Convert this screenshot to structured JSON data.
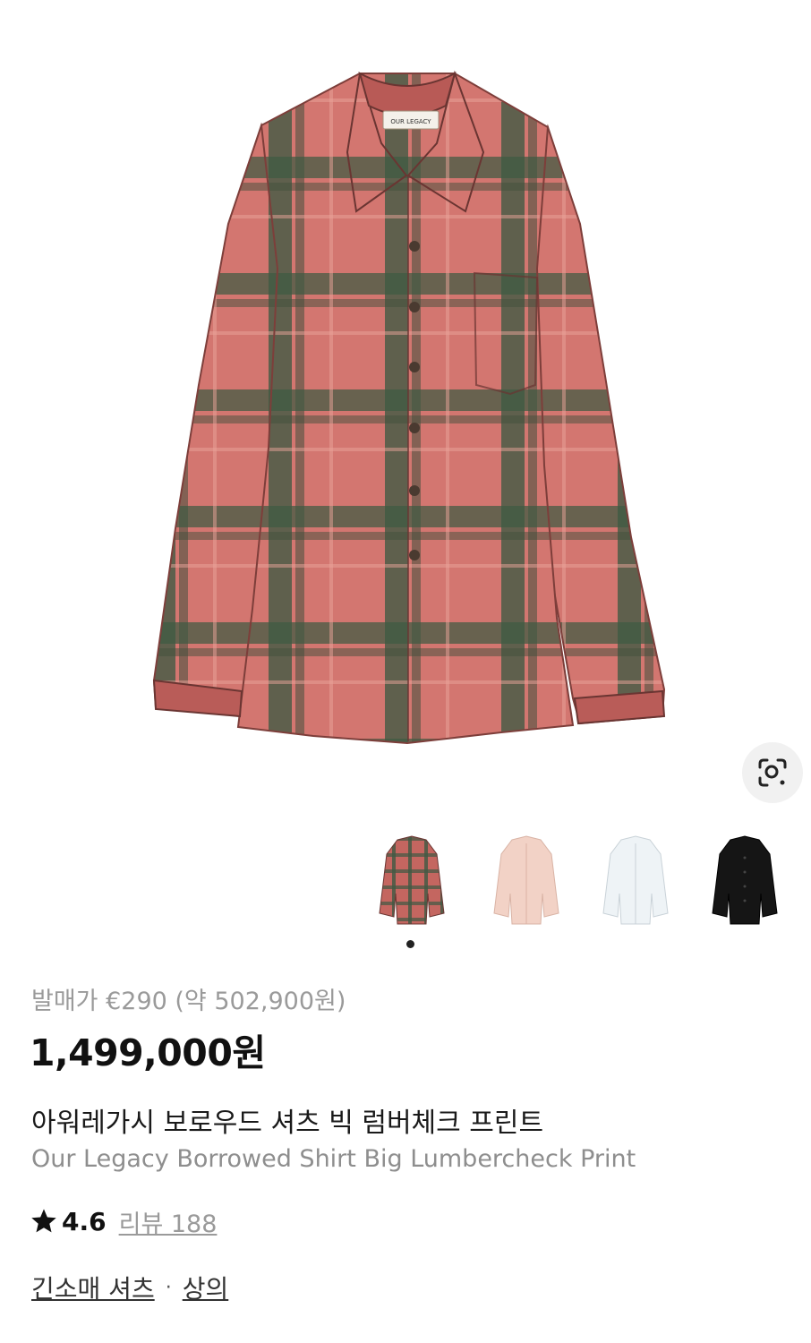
{
  "product": {
    "retail_price": "발매가 €290 (약 502,900원)",
    "price": "1,499,000원",
    "name_ko": "아워레가시 보로우드 셔츠 빅 럼버체크 프린트",
    "name_en": "Our Legacy Borrowed Shirt Big Lumbercheck Print",
    "brand_label": "OUR LEGACY",
    "rating": "4.6",
    "review_link": "리뷰 188",
    "categories": [
      "긴소매 셔츠",
      "상의"
    ],
    "separator": "·"
  },
  "gallery": {
    "thumbnails": [
      {
        "name": "red-check",
        "color": "#b0544f",
        "selected": true
      },
      {
        "name": "pink",
        "color": "#f2d2c6",
        "selected": false
      },
      {
        "name": "white",
        "color": "#eef2f4",
        "selected": false
      },
      {
        "name": "black",
        "color": "#151515",
        "selected": false
      }
    ],
    "lens_icon": "visual-search-icon"
  },
  "colors": {
    "check_red": "#c96462",
    "check_green": "#3e5440",
    "star": "#111111",
    "muted_text": "#9a9a9a"
  }
}
